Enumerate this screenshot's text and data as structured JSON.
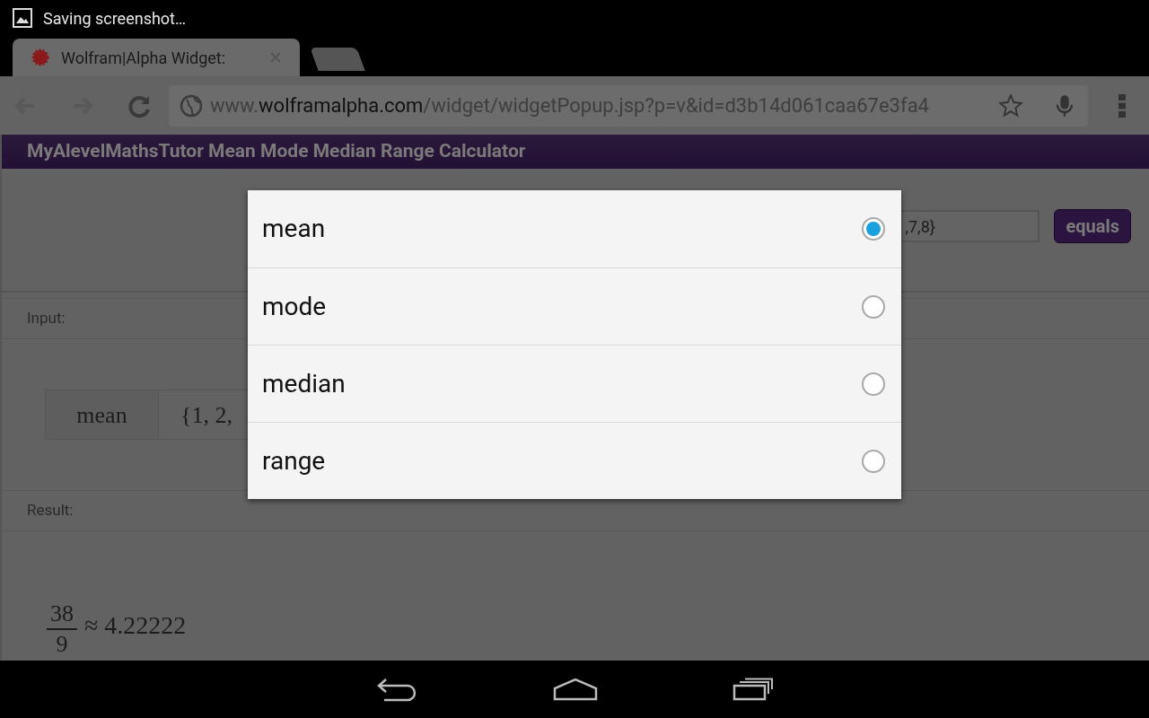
{
  "status_bar": {
    "notification": "Saving screenshot…"
  },
  "tabs": [
    {
      "title": "Wolfram|Alpha Widget:",
      "selected": true
    }
  ],
  "url": {
    "prefix": "www.",
    "domain": "wolframalpha.com",
    "path": "/widget/widgetPopup.jsp?p=v&id=d3b14d061caa67e3fa4"
  },
  "widget": {
    "title": "MyAlevelMathsTutor Mean Mode Median Range Calculator",
    "field_value": ",7,8}",
    "button": "equals",
    "input_label": "Input:",
    "input_function": "mean",
    "input_list": "{1, 2,",
    "result_label": "Result:",
    "result_numerator": "38",
    "result_denominator": "9",
    "result_approx": "≈ 4.22222"
  },
  "dialog": {
    "options": [
      {
        "label": "mean",
        "selected": true
      },
      {
        "label": "mode",
        "selected": false
      },
      {
        "label": "median",
        "selected": false
      },
      {
        "label": "range",
        "selected": false
      }
    ]
  }
}
